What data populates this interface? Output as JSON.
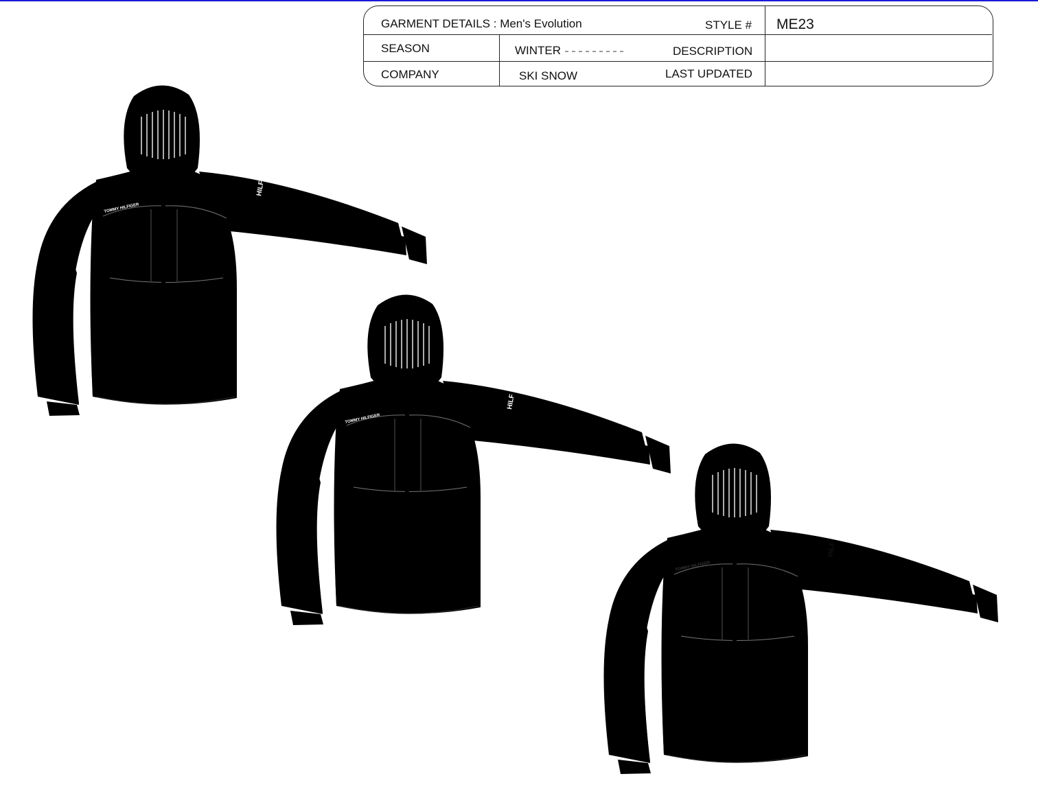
{
  "spec_sheet": {
    "garment_label": "GARMENT DETAILS : ",
    "garment_value": "Men's Evolution",
    "style_label": "STYLE #",
    "style_value": "ME23",
    "season_label": "SEASON",
    "season_value": "WINTER",
    "description_label": "DESCRIPTION",
    "company_label": "COMPANY",
    "company_value": "SKI SNOW",
    "last_updated_label": "LAST UPDATED"
  },
  "jackets": [
    {
      "colorway": "red",
      "body": "#e8161c",
      "panel": "#3b4048",
      "trim": "#000000",
      "zipper": "#555555",
      "hem": "#cccccc"
    },
    {
      "colorway": "black",
      "body": "#050505",
      "panel": "#3b4048",
      "trim": "#000000",
      "zipper": "#777777",
      "hem": "#cccccc"
    },
    {
      "colorway": "white",
      "body": "#ffffff",
      "panel": "#f6f6f6",
      "trim": "#000000",
      "zipper": "#333333",
      "hem": "#cccccc"
    }
  ],
  "branding": {
    "chest_text": "TOMMY HILFIGER",
    "sleeve_text": "HILF"
  },
  "colors": {
    "top_rule": "#1a1ad6",
    "border": "#222222"
  }
}
